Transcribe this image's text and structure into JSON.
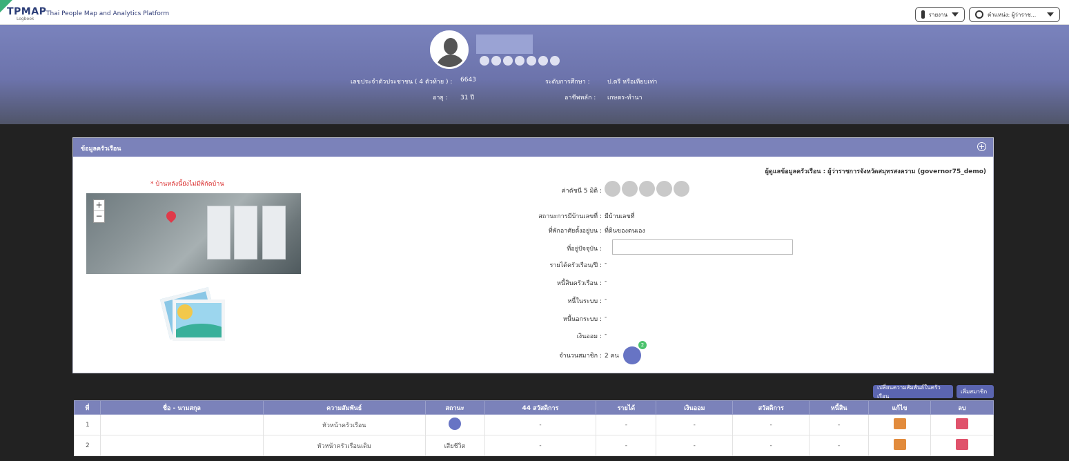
{
  "app": {
    "logo": "TPMAP",
    "logo_sub": "Logbook",
    "platform": "Thai People Map and Analytics Platform",
    "report_btn": "รายงาน",
    "user_btn": "ตำแหน่ง: ผู้ว่าราช..."
  },
  "profile": {
    "id_label": "เลขประจำตัวประชาชน ( 4 ตัวท้าย )  :",
    "id_value": "6643",
    "age_label": "อายุ  :",
    "age_value": "31 ปี",
    "edu_label": "ระดับการศึกษา  :",
    "edu_value": "ป.ตรี หรือเทียบเท่า",
    "job_label": "อาชีพหลัก  :",
    "job_value": "เกษตร-ทำนา"
  },
  "household": {
    "title": "ข้อมูลครัวเรือน",
    "owner_label": "ผู้ดูแลข้อมูลครัวเรือน : ผู้ว่าราชการจังหวัดสมุทรสงคราม (governor75_demo)",
    "no_coord": "* บ้านหลังนี้ยังไม่มีพิกัดบ้าน",
    "zoom_in": "+",
    "zoom_out": "−",
    "fields": {
      "index5": "ค่าดัชนี 5 มิติ :",
      "home_status": "สถานะการมีบ้านเลขที่ :",
      "home_status_value": "มีบ้านเลขที่",
      "residence": "ที่พักอาศัยตั้งอยู่บน :",
      "residence_value": "ที่ดินของตนเอง",
      "address": "ที่อยู่ปัจจุบัน :",
      "income": "รายได้ครัวเรือน/ปี :",
      "income_value": "-",
      "debt": "หนี้สินครัวเรือน :",
      "debt_value": "-",
      "debt_in": "หนี้ในระบบ :",
      "debt_in_value": "-",
      "debt_out": "หนี้นอกระบบ :",
      "debt_out_value": "-",
      "savings": "เงินออม :",
      "savings_value": "-",
      "members": "จำนวนสมาชิก :",
      "members_value": "2 คน",
      "members_badge": "2"
    }
  },
  "actions": {
    "change_relation": "เปลี่ยนความสัมพันธ์ในครัวเรือน",
    "add_member": "เพิ่มสมาชิก"
  },
  "table": {
    "headers": [
      "ที่",
      "ชื่อ - นามสกุล",
      "ความสัมพันธ์",
      "สถานะ",
      "44 สวัสดิการ",
      "รายได้",
      "เงินออม",
      "สวัสดิการ",
      "หนี้สิน",
      "แก้ไข",
      "ลบ"
    ],
    "rows": [
      {
        "idx": "1",
        "name": "",
        "relation": "หัวหน้าครัวเรือน",
        "status": "",
        "welfare44": "-",
        "income": "-",
        "savings": "-",
        "welfare": "-",
        "debt": "-"
      },
      {
        "idx": "2",
        "name": "",
        "relation": "หัวหน้าครัวเรือนเดิม",
        "status": "เสียชีวิต",
        "welfare44": "-",
        "income": "-",
        "savings": "-",
        "welfare": "-",
        "debt": "-"
      }
    ]
  }
}
